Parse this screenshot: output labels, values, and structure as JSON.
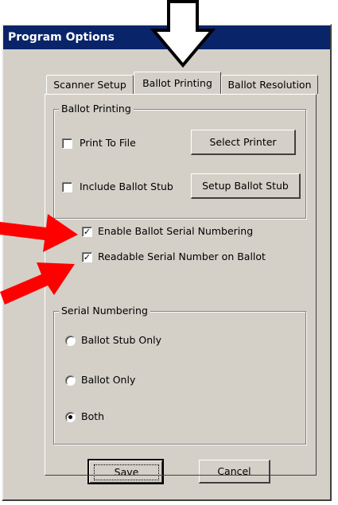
{
  "window": {
    "title": "Program Options"
  },
  "tabs": [
    {
      "label": "Scanner Setup",
      "active": false
    },
    {
      "label": "Ballot Printing",
      "active": true
    },
    {
      "label": "Ballot Resolution",
      "active": false
    }
  ],
  "ballot_printing_group": {
    "label": "Ballot Printing",
    "print_to_file": {
      "label": "Print To File",
      "checked": false
    },
    "include_ballot_stub": {
      "label": "Include Ballot Stub",
      "checked": false
    },
    "select_printer_button": "Select Printer",
    "setup_ballot_stub_button": "Setup Ballot Stub"
  },
  "enable_serial_numbering": {
    "label": "Enable Ballot Serial Numbering",
    "checked": true,
    "mark": "✓"
  },
  "readable_serial_number": {
    "label": "Readable Serial Number on Ballot",
    "checked": true,
    "mark": "✓"
  },
  "serial_numbering_group": {
    "label": "Serial Numbering",
    "options": [
      {
        "label": "Ballot Stub Only",
        "selected": false
      },
      {
        "label": "Ballot Only",
        "selected": false
      },
      {
        "label": "Both",
        "selected": true
      }
    ]
  },
  "buttons": {
    "save": "Save",
    "cancel": "Cancel"
  },
  "colors": {
    "titlebar": "#0a246a",
    "dialog_bg": "#d4d0c8",
    "annotation_arrow": "#ff0000"
  }
}
